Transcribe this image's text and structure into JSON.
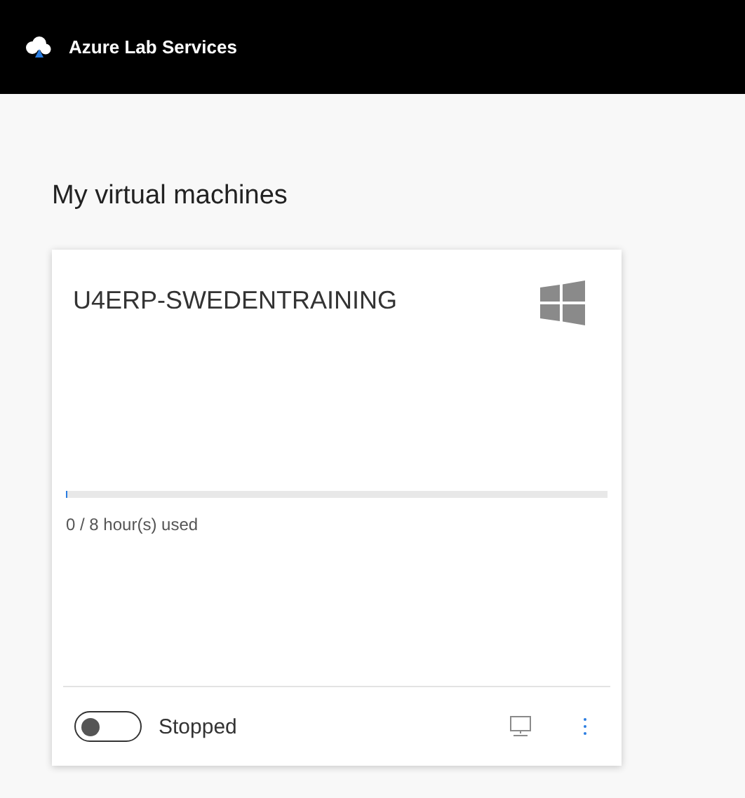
{
  "header": {
    "title": "Azure Lab Services"
  },
  "heading": "My virtual machines",
  "machines": [
    {
      "name": "U4ERP-SWEDENTRAINING",
      "kind": "windows",
      "usage": {
        "level": 0,
        "text": "0 / 8 hour(s) used"
      },
      "running": false,
      "status": "Stopped"
    }
  ]
}
